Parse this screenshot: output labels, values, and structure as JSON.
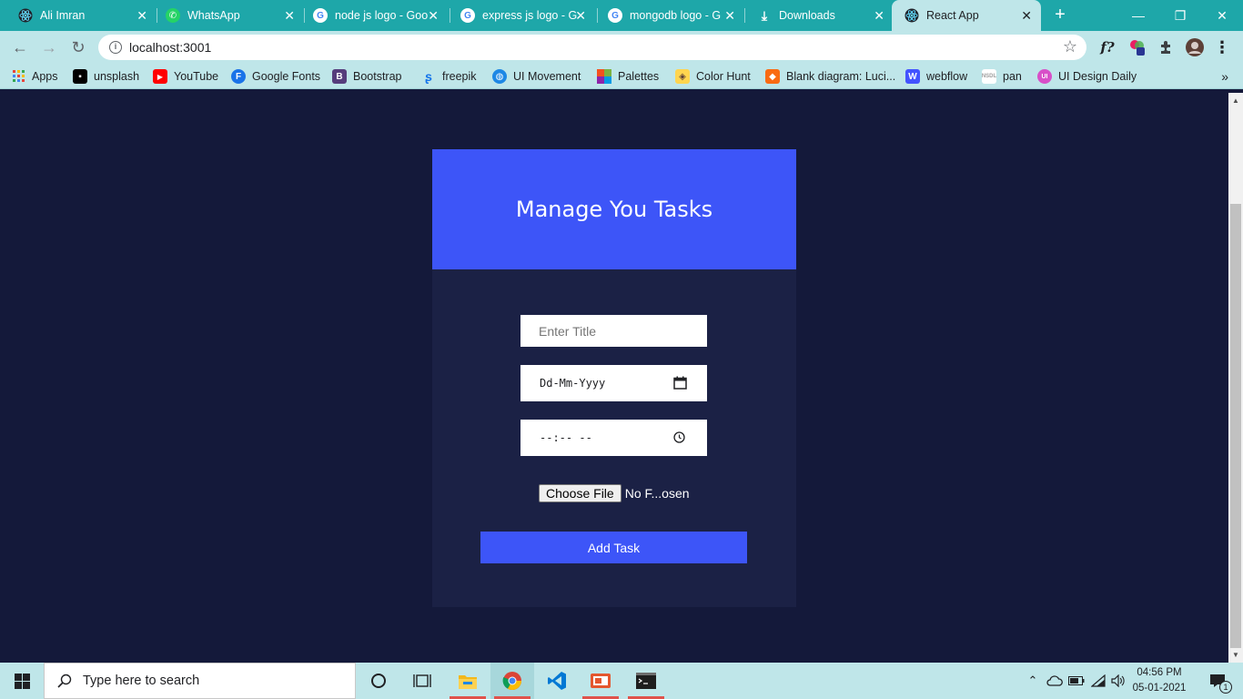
{
  "browser": {
    "tabs": [
      {
        "title": "Ali Imran",
        "icon": "react-icon",
        "active": false
      },
      {
        "title": "WhatsApp",
        "icon": "whatsapp-icon",
        "active": false
      },
      {
        "title": "node js logo - Goo",
        "icon": "google-icon",
        "active": false
      },
      {
        "title": "express js logo - G",
        "icon": "google-icon",
        "active": false
      },
      {
        "title": "mongodb logo - G",
        "icon": "google-icon",
        "active": false
      },
      {
        "title": "Downloads",
        "icon": "download-icon",
        "active": false
      },
      {
        "title": "React App",
        "icon": "react-icon",
        "active": true
      }
    ],
    "new_tab_label": "+",
    "address": "localhost:3001",
    "bookmarks": [
      {
        "label": "Apps",
        "icon": "apps-grid-icon",
        "color": "#e8453c"
      },
      {
        "label": "unsplash",
        "icon": "unsplash-icon",
        "color": "#000000"
      },
      {
        "label": "YouTube",
        "icon": "youtube-icon",
        "color": "#ff0000"
      },
      {
        "label": "Google Fonts",
        "icon": "google-fonts-icon",
        "color": "#1a73e8"
      },
      {
        "label": "Bootstrap",
        "icon": "bootstrap-icon",
        "color": "#563d7c"
      },
      {
        "label": "freepik",
        "icon": "freepik-icon",
        "color": "#1273eb"
      },
      {
        "label": "UI Movement",
        "icon": "ui-movement-icon",
        "color": "#1e88e5"
      },
      {
        "label": "Palettes",
        "icon": "palettes-icon",
        "color": "#f4511e"
      },
      {
        "label": "Color Hunt",
        "icon": "color-hunt-icon",
        "color": "#8d6e63"
      },
      {
        "label": "Blank diagram: Luci...",
        "icon": "lucidchart-icon",
        "color": "#f96b13"
      },
      {
        "label": "webflow",
        "icon": "webflow-icon",
        "color": "#4353ff"
      },
      {
        "label": "pan",
        "icon": "nsdl-icon",
        "color": "#9e9e9e"
      },
      {
        "label": "UI Design Daily",
        "icon": "ui-design-daily-icon",
        "color": "#d84fc8"
      }
    ]
  },
  "app": {
    "title": "Manage You Tasks",
    "title_placeholder": "Enter Title",
    "date_placeholder": "Dd-Mm-Yyyy",
    "time_placeholder": "--:-- --",
    "file_button": "Choose File",
    "file_status": "No F...osen",
    "submit_label": "Add Task",
    "colors": {
      "accent": "#3d55f8",
      "page_bg": "#14193a",
      "card_bg": "#1b2145"
    }
  },
  "taskbar": {
    "search_placeholder": "Type here to search",
    "time": "04:56 PM",
    "date": "05-01-2021",
    "notification_count": "1"
  }
}
